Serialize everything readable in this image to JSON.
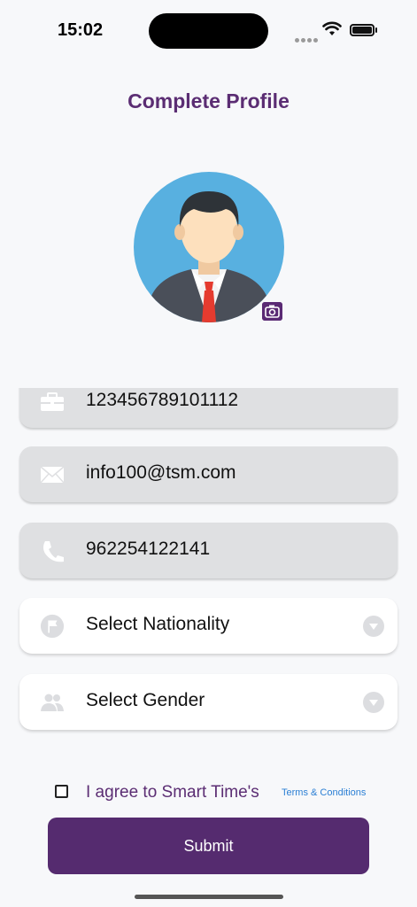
{
  "status_bar": {
    "time": "15:02"
  },
  "header": {
    "title": "Complete Profile"
  },
  "avatar": {
    "icon": "person-avatar-icon",
    "edit_icon": "camera-icon"
  },
  "fields": {
    "id_number": {
      "value": "123456789101112",
      "icon": "briefcase-icon"
    },
    "email": {
      "value": "info100@tsm.com",
      "icon": "mail-icon"
    },
    "phone": {
      "value": "962254122141",
      "icon": "phone-icon"
    },
    "nationality": {
      "placeholder": "Select Nationality",
      "icon": "flag-icon"
    },
    "gender": {
      "placeholder": "Select Gender",
      "icon": "people-icon"
    }
  },
  "agreement": {
    "label": "I agree to Smart Time's",
    "link": "Terms & Conditions"
  },
  "submit_label": "Submit",
  "colors": {
    "primary": "#552b6f",
    "title": "#5b2d73",
    "link": "#2b7fd4",
    "field_disabled": "#dfe0e2"
  }
}
